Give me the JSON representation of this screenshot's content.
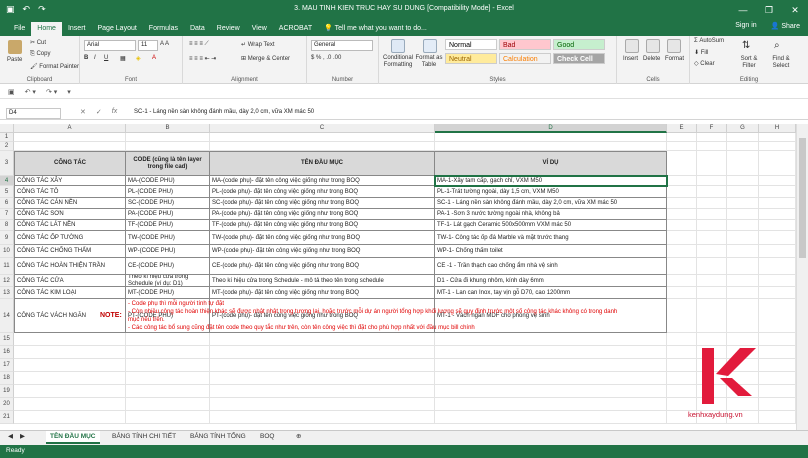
{
  "window": {
    "title": "3. MAU TINH KIEN TRUC HAY SU DUNG  [Compatibility Mode]  -  Excel",
    "buttons": [
      "—",
      "❐",
      "✕"
    ]
  },
  "menu": {
    "tabs": [
      "File",
      "Home",
      "Insert",
      "Page Layout",
      "Formulas",
      "Data",
      "Review",
      "View",
      "ACROBAT"
    ],
    "tell_me": "Tell me what you want to do...",
    "sign_in": "Sign in",
    "share": "Share"
  },
  "ribbon": {
    "clipboard": {
      "label": "Clipboard",
      "paste": "Paste",
      "cut": "Cut",
      "copy": "Copy",
      "format_painter": "Format Painter"
    },
    "font": {
      "label": "Font",
      "name": "Arial",
      "size": "11"
    },
    "alignment": {
      "label": "Alignment",
      "wrap": "Wrap Text",
      "merge": "Merge & Center"
    },
    "number": {
      "label": "Number",
      "format": "General"
    },
    "styles": {
      "label": "Styles",
      "conditional": "Conditional Formatting",
      "format_table": "Format as Table",
      "items": [
        {
          "name": "Normal",
          "bg": "#ffffff",
          "fg": "#000000"
        },
        {
          "name": "Bad",
          "bg": "#ffc7ce",
          "fg": "#9c0006"
        },
        {
          "name": "Good",
          "bg": "#c6efce",
          "fg": "#006100"
        },
        {
          "name": "Neutral",
          "bg": "#ffeb9c",
          "fg": "#9c6500"
        },
        {
          "name": "Calculation",
          "bg": "#f2f2f2",
          "fg": "#fa7d00"
        },
        {
          "name": "Check Cell",
          "bg": "#a5a5a5",
          "fg": "#ffffff"
        }
      ]
    },
    "cells": {
      "label": "Cells",
      "insert": "Insert",
      "delete": "Delete",
      "format": "Format"
    },
    "editing": {
      "label": "Editing",
      "autosum": "AutoSum",
      "fill": "Fill",
      "clear": "Clear",
      "sort": "Sort & Filter",
      "find": "Find & Select"
    }
  },
  "formula_bar": {
    "name_box": "D4",
    "fx": "fx",
    "content": "SC-1 - Láng nền sàn không đánh mầu, dày 2,0 cm, vữa XM mác 50"
  },
  "columns": [
    "A",
    "B",
    "C",
    "D",
    "E",
    "F",
    "G",
    "H"
  ],
  "rows": [
    "1",
    "2",
    "3",
    "4",
    "5",
    "6",
    "7",
    "8",
    "9",
    "10",
    "11",
    "12",
    "13",
    "14",
    "15",
    "16",
    "17",
    "18",
    "19",
    "20",
    "21"
  ],
  "table": {
    "headers": [
      "CÔNG TÁC",
      "CODE (cũng là tên layer trong file cad)",
      "TÊN ĐẦU MỤC",
      "VÍ DỤ"
    ],
    "rows": [
      [
        "CÔNG TÁC XÂY",
        "MA-(CODE PHU)",
        "MA-(code phụ)- đặt tên công việc giống như trong BOQ",
        "MA-1-Xây tam cấp, gạch chỉ, VXM M50"
      ],
      [
        "CÔNG TÁC TÔ",
        "PL-(CODE PHU)",
        "PL-(code phụ)- đặt tên công việc giống như trong BOQ",
        "PL-1-Trát tường ngoài, dày 1,5 cm, VXM M50"
      ],
      [
        "CÔNG TÁC CÁN NỀN",
        "SC-(CODE PHU)",
        "SC-(code phụ)- đặt tên công việc giống như trong BOQ",
        "SC-1 - Láng nền sàn không đánh mầu, dày 2,0 cm, vữa XM mác 50"
      ],
      [
        "CÔNG TÁC SƠN",
        "PA-(CODE PHU)",
        "PA-(code phụ)- đặt tên công việc giống như trong BOQ",
        "PA-1 -Sơn 3 nước tường ngoài nhà, không bả"
      ],
      [
        "CÔNG TÁC LÁT NỀN",
        "TF-(CODE PHU)",
        "TF-(code phụ)- đặt tên công việc giống như trong BOQ",
        "TF-1- Lát gạch Ceramic 500x500mm VXM mác 50"
      ],
      [
        "CÔNG TÁC ỐP TƯỜNG",
        "TW-(CODE PHU)",
        "TW-(code phụ)- đặt tên công việc giống như trong BOQ",
        "TW-1- Công tác ốp đá Marble và mặt trước thang"
      ],
      [
        "CÔNG TÁC CHỐNG THẤM",
        "WP-(CODE PHU)",
        "WP-(code phụ)- đặt tên công việc giống như trong BOQ",
        "WP-1- Chống thấm toilet"
      ],
      [
        "CÔNG TÁC HOÀN THIỆN TRẦN",
        "CE-(CODE PHU)",
        "CE-(code phụ)- đặt tên công việc giống như trong BOQ",
        "CE -1 - Trần thạch cao chống ẩm nhà vệ sinh"
      ],
      [
        "CÔNG TÁC CỬA",
        "Theo kí hiệu cửa trong Schedule (ví dụ: D1)",
        "Theo kí hiệu cửa trong Schedule - mô tả theo tên trong schedule",
        "D1 - Cửa đi khung nhôm, kính dày 6mm"
      ],
      [
        "CÔNG TÁC KIM LOẠI",
        "MT-(CODE PHU)",
        "MT-(code phụ)- đặt tên công việc giống như trong BOQ",
        "MT-1 - Lan can Inox, tay vịn gỗ D70, cao 1200mm"
      ],
      [
        "CÔNG TÁC VÁCH NGĂN",
        "PT-(CODE PHU)",
        "PT-(code phụ)- đặt tên công việc giống như trong BOQ",
        "MT-1 - Vách ngăn MDF cho phòng vệ sinh"
      ]
    ]
  },
  "note": {
    "label": "NOTE:",
    "lines": [
      "- Code phụ thì mỗi người tính tự đặt",
      "- Còn nhiều công tác hoàn thiện khác sẽ được nhật nhật trong tương lai, hoặc trước mỗi dự án người tổng hợp khối lượng sẽ quy định trước một số công tác khác không có trong danh",
      "mục nếu trên.",
      "- Các công tác bổ sung cũng đặt tên code theo quy tắc như trên, còn tên công việc thì đặt cho phù hợp nhất với đầu mục bill chính"
    ]
  },
  "watermark": {
    "text": "kenhxaydung.vn",
    "color": "#c8102e"
  },
  "sheets": [
    "TÊN ĐẦU MỤC",
    "BẢNG TÍNH CHI TIẾT",
    "BẢNG TÍNH TỔNG",
    "BOQ"
  ],
  "status": "Ready"
}
